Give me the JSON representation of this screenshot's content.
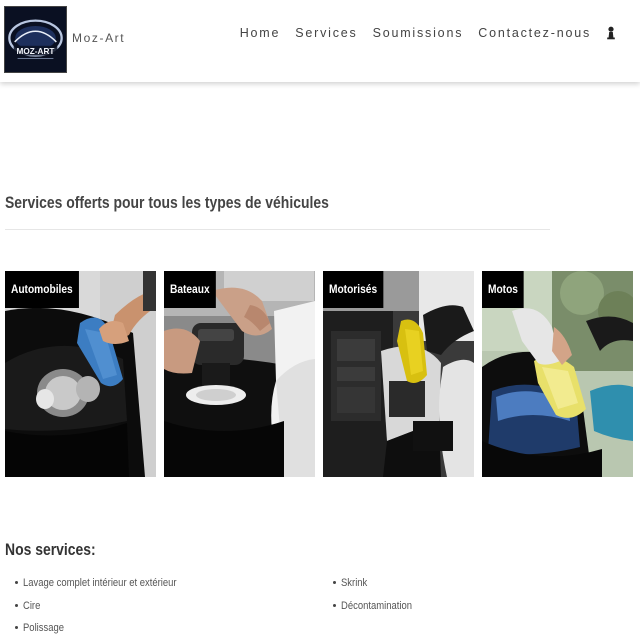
{
  "header": {
    "brand": "Moz-Art",
    "logo_text": "MOZ-ART",
    "nav": [
      "Home",
      "Services",
      "Soumissions",
      "Contactez-nous"
    ],
    "user_icon": "user-icon"
  },
  "section": {
    "title": "Services offerts pour tous les types de véhicules"
  },
  "tiles": [
    {
      "label": "Automobiles"
    },
    {
      "label": "Bateaux"
    },
    {
      "label": "Motorisés"
    },
    {
      "label": "Motos"
    }
  ],
  "services": {
    "heading": "Nos services:",
    "left": [
      "Lavage complet intérieur et extérieur",
      "Cire",
      "Polissage"
    ],
    "right": [
      "Skrink",
      "Décontamination"
    ]
  },
  "colors": {
    "label_bg": "#000000",
    "label_text": "#ffffff",
    "logo_bg": "#0a1022"
  }
}
